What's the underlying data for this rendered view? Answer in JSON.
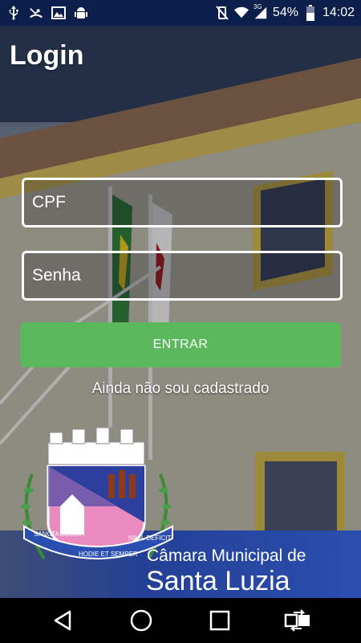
{
  "status_bar": {
    "battery_text": "54%",
    "time": "14:02",
    "network": "3G",
    "icons_left": [
      "usb-icon",
      "missed-call-icon",
      "image-icon",
      "android-debug-icon"
    ],
    "icons_right": [
      "mute-icon",
      "wifi-icon",
      "signal-icon",
      "battery-icon"
    ]
  },
  "page": {
    "title": "Login"
  },
  "form": {
    "cpf_placeholder": "CPF",
    "password_placeholder": "Senha",
    "submit_label": "ENTRAR",
    "register_link": "Ainda não sou cadastrado"
  },
  "brand": {
    "line1": "Câmara Municipal de",
    "line2": "Santa Luzia",
    "crest_ribbon_left": "SANCTA LUCCIA",
    "crest_ribbon_center": "HODIE ET SEMPER",
    "crest_ribbon_right": "NIHIL DÉFICIT"
  },
  "building_sign": "Câmara Municipal de Santa Luzia",
  "colors": {
    "accent_button": "#5cb85c",
    "status_bar": "#0b1f4a",
    "brand_blue": "#2a4fb0"
  },
  "nav_bar": {
    "icons": [
      "back-icon",
      "home-icon",
      "recents-icon",
      "screen-share-icon"
    ]
  }
}
